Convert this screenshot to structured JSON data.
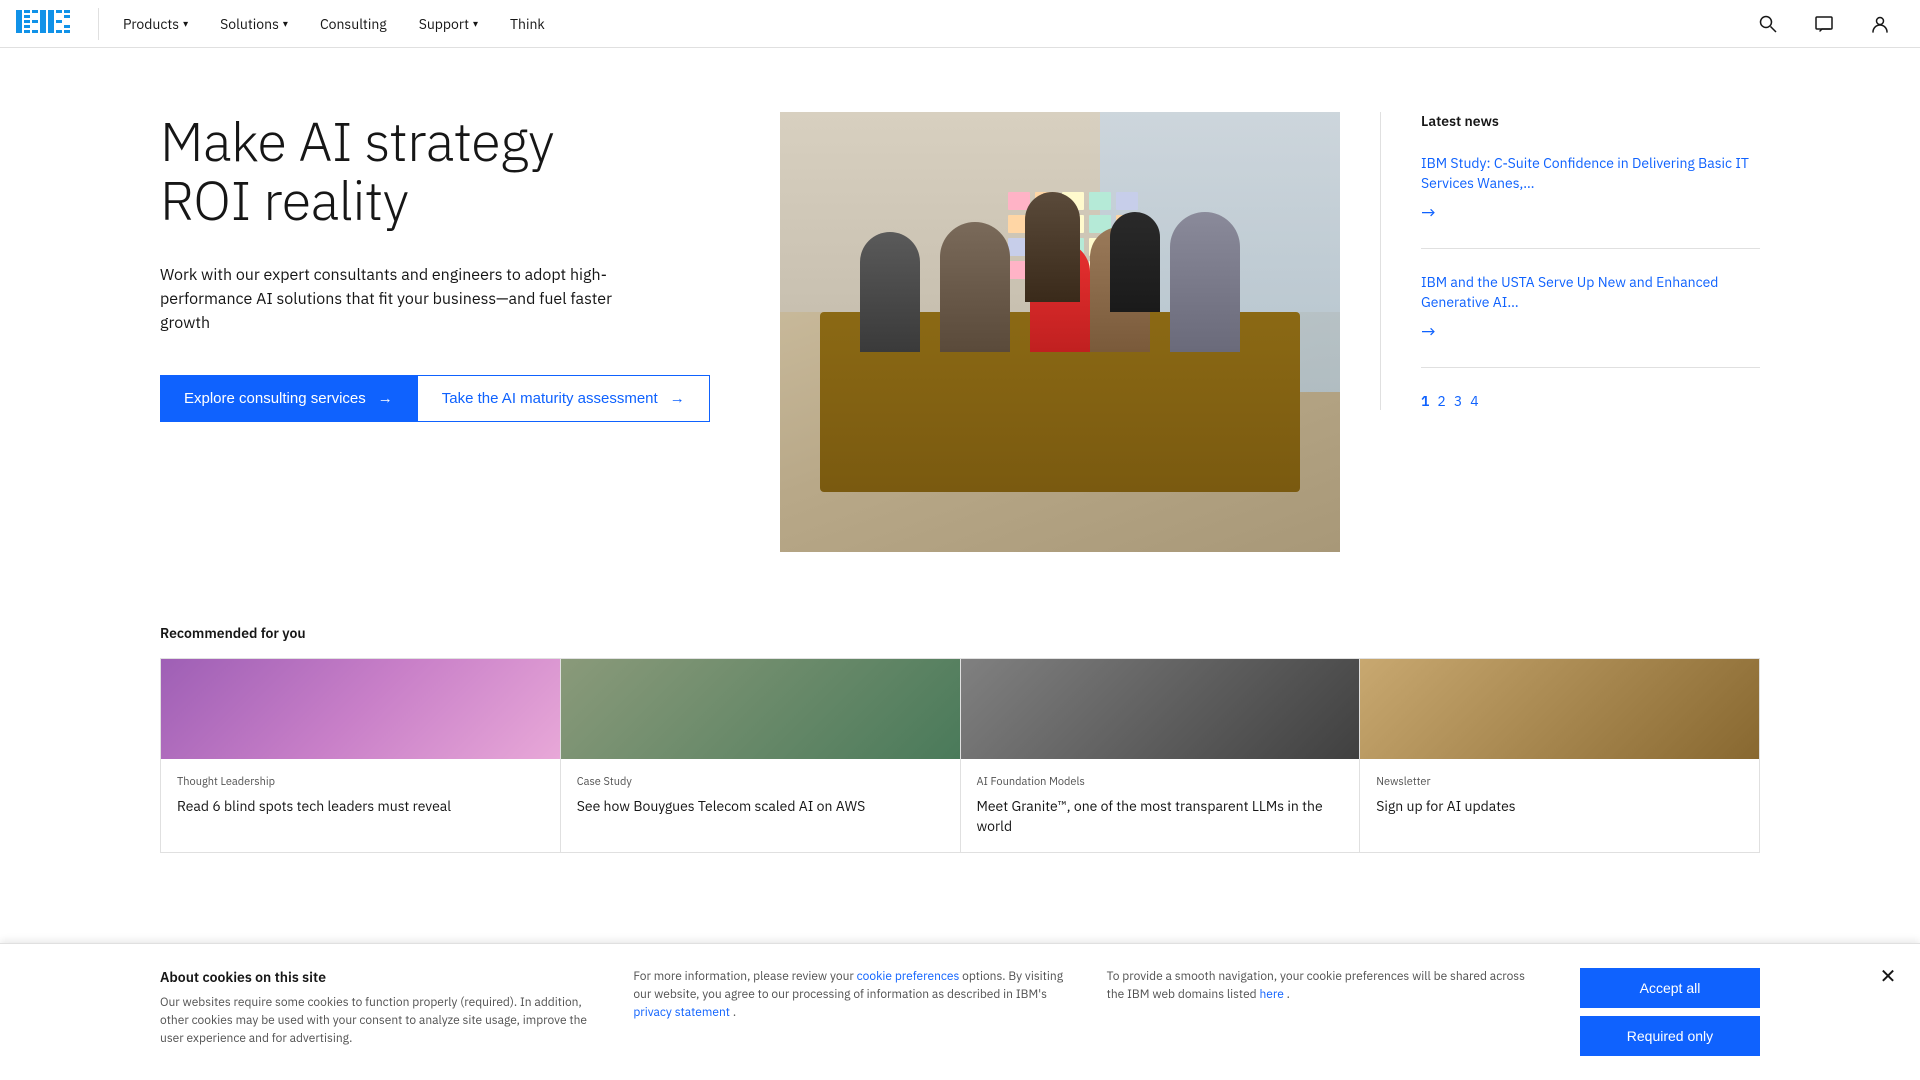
{
  "nav": {
    "products_label": "Products",
    "solutions_label": "Solutions",
    "consulting_label": "Consulting",
    "support_label": "Support",
    "think_label": "Think"
  },
  "hero": {
    "title_line1": "Make AI strategy",
    "title_line2": "ROI reality",
    "subtitle": "Work with our expert consultants and engineers to adopt high-performance AI solutions that fit your business—and fuel faster growth",
    "btn_primary": "Explore consulting services",
    "btn_outline": "Take the AI maturity assessment"
  },
  "news": {
    "section_title": "Latest news",
    "item1": {
      "text": "IBM Study: C-Suite Confidence in Delivering Basic IT Services Wanes,…"
    },
    "item2": {
      "text": "IBM and the USTA Serve Up New and Enhanced Generative AI…"
    },
    "pagination": [
      "1",
      "2",
      "3",
      "4"
    ]
  },
  "recommended": {
    "title": "Recommended for you",
    "cards": [
      {
        "tag": "Thought leadership",
        "text": "Read 6 blind spots tech leaders must reveal",
        "img_type": "purple"
      },
      {
        "tag": "Case study",
        "text": "See how Bouygues Telecom scaled AI on AWS",
        "img_type": "person"
      },
      {
        "tag": "AI foundation models",
        "text": "Meet Granite™, one of the most transparent LLMs in the world",
        "img_type": "rock"
      },
      {
        "tag": "Newsletter",
        "text": "Sign up for AI updates",
        "img_type": "interior"
      }
    ]
  },
  "cookie": {
    "section1_title": "About cookies on this site",
    "section1_text": "Our websites require some cookies to function properly (required). In addition, other cookies may be used with your consent to analyze site usage, improve the user experience and for advertising.",
    "section2_text": "For more information, please review your ",
    "section2_link1": "cookie preferences",
    "section2_mid": " options. By visiting our website, you agree to our processing of information as described in IBM's ",
    "section2_link2": "privacy statement",
    "section2_end": ".",
    "section3_text": "To provide a smooth navigation, your cookie preferences will be shared across the IBM web domains listed ",
    "section3_link": "here",
    "section3_end": ".",
    "btn_accept": "Accept all",
    "btn_required": "Required only"
  }
}
